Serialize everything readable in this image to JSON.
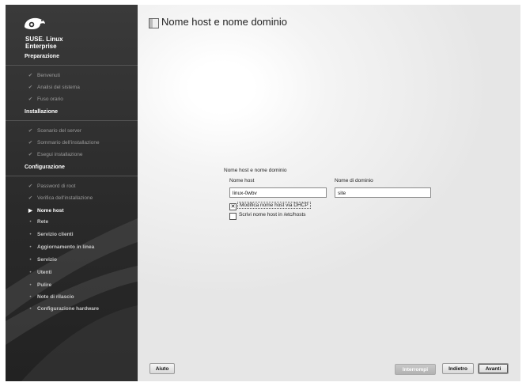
{
  "brand": {
    "line1": "SUSE. Linux",
    "line2": "Enterprise"
  },
  "sidebar": {
    "sections": [
      {
        "title": "Preparazione",
        "steps": [
          {
            "label": "Benvenuti",
            "state": "done"
          },
          {
            "label": "Analisi del sistema",
            "state": "done"
          },
          {
            "label": "Fuso orario",
            "state": "done"
          }
        ]
      },
      {
        "title": "Installazione",
        "steps": [
          {
            "label": "Scenario del server",
            "state": "done"
          },
          {
            "label": "Sommario dell'installazione",
            "state": "done"
          },
          {
            "label": "Esegui installazione",
            "state": "done"
          }
        ]
      },
      {
        "title": "Configurazione",
        "steps": [
          {
            "label": "Password di root",
            "state": "done"
          },
          {
            "label": "Verifica dell'installazione",
            "state": "done"
          },
          {
            "label": "Nome host",
            "state": "current"
          },
          {
            "label": "Rete",
            "state": "todo"
          },
          {
            "label": "Servizio clienti",
            "state": "todo"
          },
          {
            "label": "Aggiornamento in linea",
            "state": "todo"
          },
          {
            "label": "Servizio",
            "state": "todo"
          },
          {
            "label": "Utenti",
            "state": "todo"
          },
          {
            "label": "Pulire",
            "state": "todo"
          },
          {
            "label": "Note di rilascio",
            "state": "todo"
          },
          {
            "label": "Configurazione hardware",
            "state": "todo"
          }
        ]
      }
    ]
  },
  "dialog": {
    "title": "Nome host e nome dominio",
    "group_label": "Nome host e nome dominio",
    "hostname_label": "Nome host",
    "hostname_value": "linux-0wbv",
    "domain_label": "Nome di dominio",
    "domain_value": "site",
    "dhcp_label": "Modifica nome host via DHCP",
    "dhcp_checked": true,
    "hosts_label": "Scrivi nome host in /etc/hosts",
    "hosts_checked": false
  },
  "buttons": {
    "help": "Aiuto",
    "abort": "Interrompi",
    "back": "Indietro",
    "next": "Avanti"
  },
  "colors": {
    "sidebar_bg": "#2e2e2e",
    "sidebar_text": "#ffffff",
    "check_mark": "#8a8a8a"
  }
}
